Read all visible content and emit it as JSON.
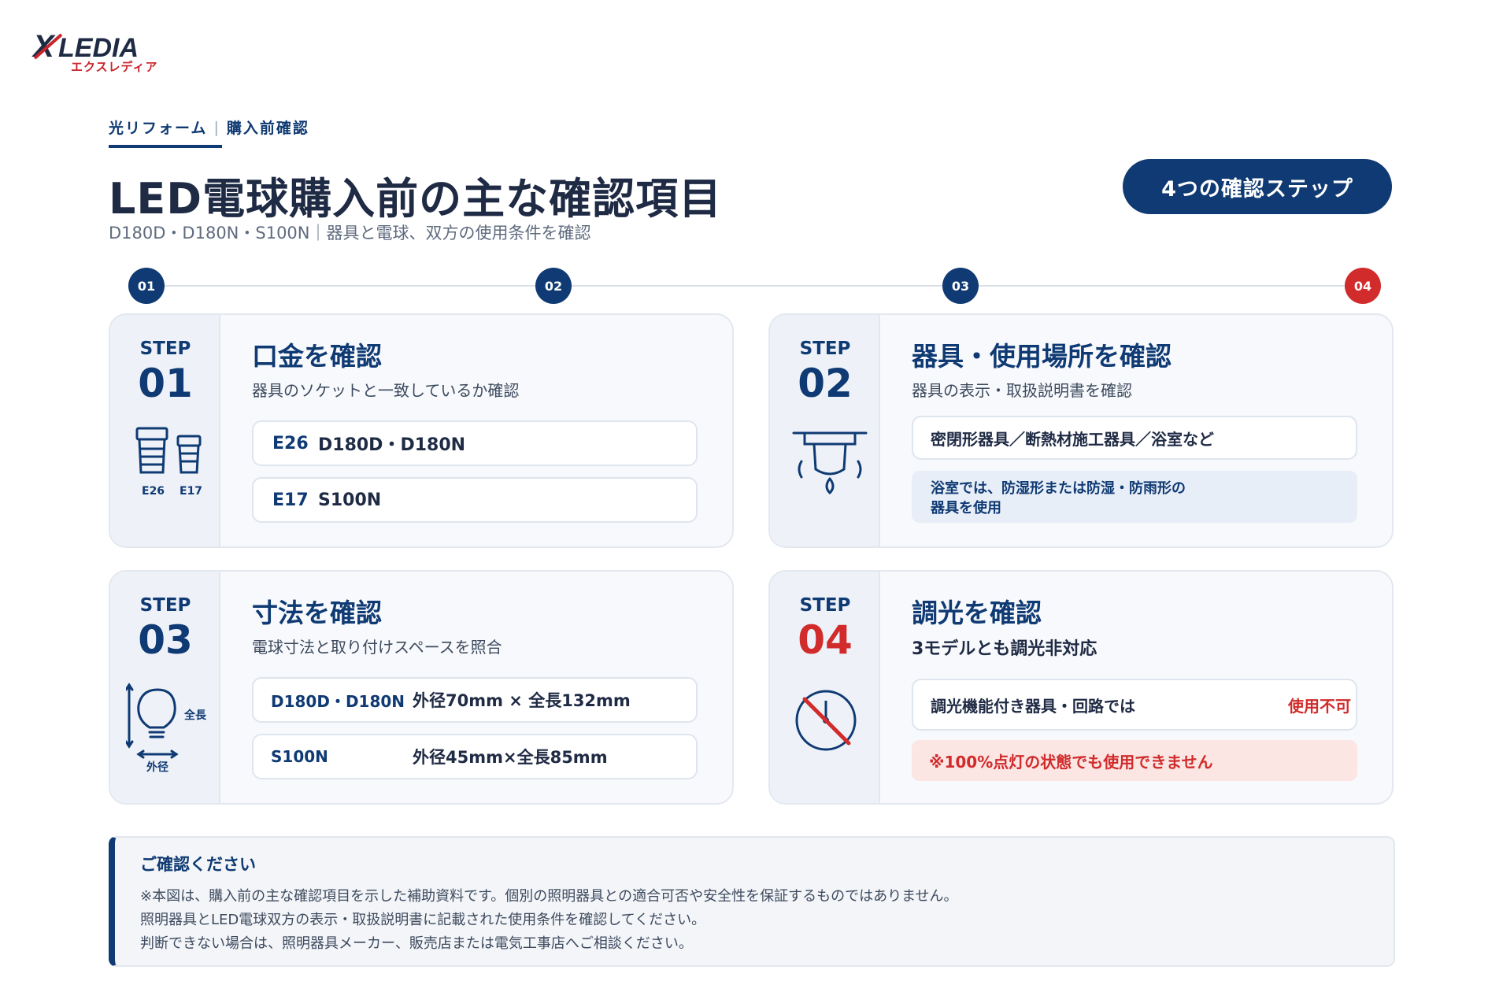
{
  "brand": {
    "logo_text": "XLEDIA",
    "logo_sub": "エクスレディア"
  },
  "breadcrumb": {
    "part1": "光リフォーム",
    "sep": "|",
    "part2": "購入前確認"
  },
  "page": {
    "title": "LED電球購入前の主な確認項目",
    "subtitle": "D180D・D180N・S100N｜器具と電球、双方の使用条件を確認",
    "pill": "4つの確認ステップ"
  },
  "timeline": [
    "01",
    "02",
    "03",
    "04"
  ],
  "steps": [
    {
      "label": "STEP",
      "num": "01",
      "heading": "口金を確認",
      "desc": "器具のソケットと一致しているか確認",
      "icon_labels": [
        "E26",
        "E17"
      ],
      "rows": [
        {
          "k": "E26",
          "v": "D180D・D180N"
        },
        {
          "k": "E17",
          "v": "S100N"
        }
      ]
    },
    {
      "label": "STEP",
      "num": "02",
      "heading": "器具・使用場所を確認",
      "desc": "器具の表示・取扱説明書を確認",
      "row": "密閉形器具／断熱材施工器具／浴室など",
      "note_line1": "浴室では、防湿形または防湿・防雨形の",
      "note_line2": "器具を使用"
    },
    {
      "label": "STEP",
      "num": "03",
      "heading": "寸法を確認",
      "desc": "電球寸法と取り付けスペースを照合",
      "icon_labels": [
        "全長",
        "外径"
      ],
      "rows": [
        {
          "k": "D180D・D180N",
          "v": "外径70mm × 全長132mm"
        },
        {
          "k": "S100N",
          "v": "外径45mm×全長85mm"
        }
      ]
    },
    {
      "label": "STEP",
      "num": "04",
      "heading": "調光を確認",
      "desc": "3モデルとも調光非対応",
      "row": "調光機能付き器具・回路では",
      "row_status": "使用不可",
      "warning": "※100%点灯の状態でも使用できません"
    }
  ],
  "footer": {
    "heading": "ご確認ください",
    "lines": [
      "※本図は、購入前の主な確認項目を示した補助資料です。個別の照明器具との適合可否や安全性を保証するものではありません。",
      "照明器具とLED電球双方の表示・取扱説明書に記載された使用条件を確認してください。",
      "判断できない場合は、照明器具メーカー、販売店または電気工事店へご相談ください。"
    ]
  },
  "colors": {
    "navy": "#0f3a73",
    "red": "#d12b2b",
    "card_bg": "#f7f9fc"
  }
}
